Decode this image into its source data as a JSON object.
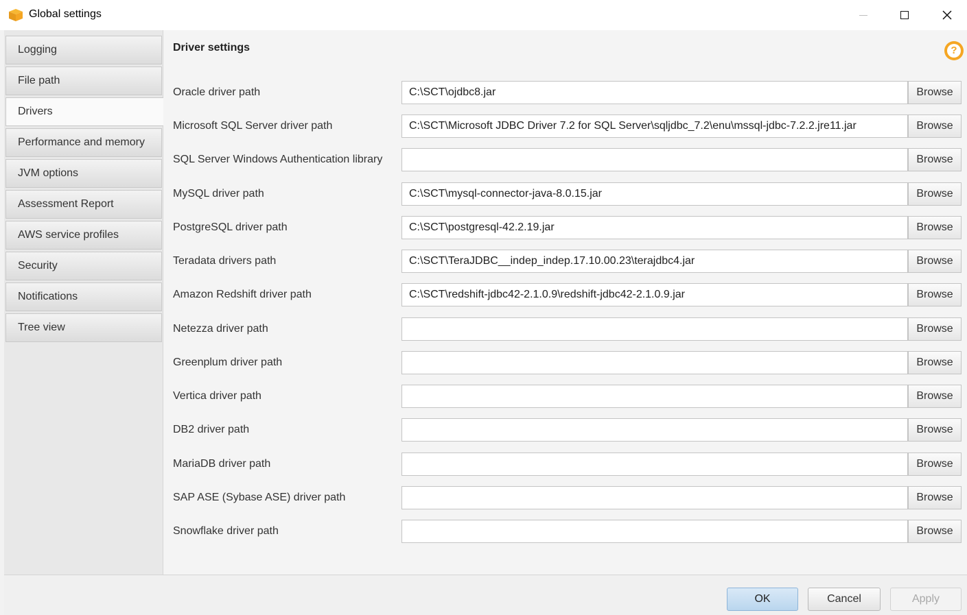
{
  "window": {
    "title": "Global settings",
    "minimize_icon": "minimize-icon",
    "maximize_icon": "maximize-icon",
    "close_icon": "close-icon"
  },
  "sidebar": {
    "items": [
      {
        "label": "Logging",
        "active": false
      },
      {
        "label": "File path",
        "active": false
      },
      {
        "label": "Drivers",
        "active": true
      },
      {
        "label": "Performance and memory",
        "active": false
      },
      {
        "label": "JVM options",
        "active": false
      },
      {
        "label": "Assessment Report",
        "active": false
      },
      {
        "label": "AWS service profiles",
        "active": false
      },
      {
        "label": "Security",
        "active": false
      },
      {
        "label": "Notifications",
        "active": false
      },
      {
        "label": "Tree view",
        "active": false
      }
    ]
  },
  "main": {
    "title": "Driver settings",
    "help_icon": "help-icon",
    "browse_label": "Browse",
    "rows": [
      {
        "label": "Oracle driver path",
        "value": "C:\\SCT\\ojdbc8.jar"
      },
      {
        "label": "Microsoft SQL Server driver path",
        "value": "C:\\SCT\\Microsoft JDBC Driver 7.2 for SQL Server\\sqljdbc_7.2\\enu\\mssql-jdbc-7.2.2.jre11.jar"
      },
      {
        "label": "SQL Server Windows Authentication library",
        "value": ""
      },
      {
        "label": "MySQL driver path",
        "value": "C:\\SCT\\mysql-connector-java-8.0.15.jar"
      },
      {
        "label": "PostgreSQL driver path",
        "value": "C:\\SCT\\postgresql-42.2.19.jar"
      },
      {
        "label": "Teradata drivers path",
        "value": "C:\\SCT\\TeraJDBC__indep_indep.17.10.00.23\\terajdbc4.jar"
      },
      {
        "label": "Amazon Redshift driver path",
        "value": "C:\\SCT\\redshift-jdbc42-2.1.0.9\\redshift-jdbc42-2.1.0.9.jar"
      },
      {
        "label": "Netezza driver path",
        "value": ""
      },
      {
        "label": "Greenplum driver path",
        "value": ""
      },
      {
        "label": "Vertica driver path",
        "value": ""
      },
      {
        "label": "DB2 driver path",
        "value": ""
      },
      {
        "label": "MariaDB driver path",
        "value": ""
      },
      {
        "label": "SAP ASE (Sybase ASE) driver path",
        "value": ""
      },
      {
        "label": "Snowflake driver path",
        "value": ""
      }
    ]
  },
  "footer": {
    "ok_label": "OK",
    "cancel_label": "Cancel",
    "apply_label": "Apply"
  },
  "colors": {
    "accent_help": "#f5a623",
    "ok_button": "#c8def2"
  }
}
